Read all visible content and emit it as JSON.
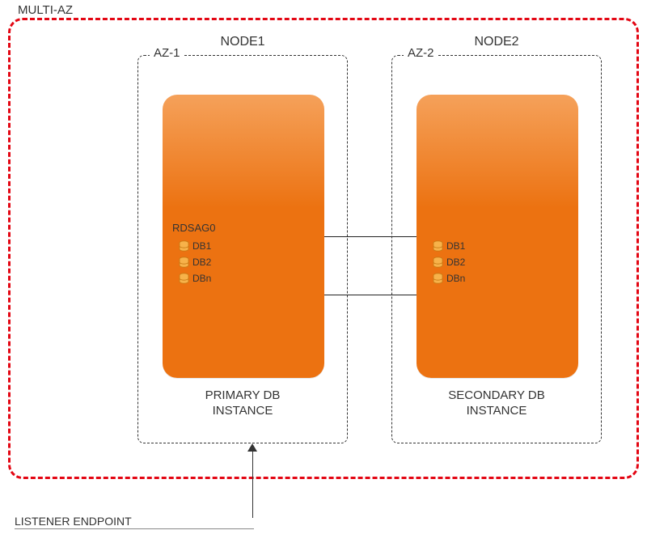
{
  "multi_az": {
    "label": "MULTI-AZ"
  },
  "az1": {
    "label": "AZ-1",
    "node": "NODE1",
    "instance_role": "PRIMARY DB\nINSTANCE",
    "rdsag_label": "RDSAG0",
    "dbs": [
      "DB1",
      "DB2",
      "DBn"
    ]
  },
  "az2": {
    "label": "AZ-2",
    "node": "NODE2",
    "instance_role": "SECONDARY DB\nINSTANCE",
    "dbs": [
      "DB1",
      "DB2",
      "DBn"
    ]
  },
  "listener": {
    "label": "LISTENER ENDPOINT"
  }
}
